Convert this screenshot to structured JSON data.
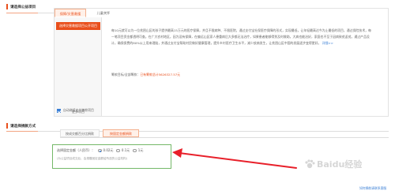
{
  "section1": {
    "title": "请选择公益项目",
    "tabs": [
      "保障/灾害救援",
      "儿童关怀"
    ],
    "selected_project_label": "选择灾害救援项目公开项目",
    "more_label": "更多项目",
    "description": "每10元就可以为一位贫困山区的孩子提供最高15万元的医疗保障，并且不限病种、不限医院，通过支付宝社保医疗保障的形式，实现最低，让年轻最高达今为止最低的项目，通过保险技术，每一笔项目资金都透明可查。在广大农村地区，因为没有保障，在偏远山区家人患重病后大多都无法治疗，如果患者能够得到及时救助，大病也能治好，家庭也不至于因病致贫返贫。通过产品设计，确保保费的80%以上用来理赔，并通过支付宝帮助村民做好健康管理，提升乡村医疗卫生水平，减少疾病发生，让贫困山区中国的发展逐步变得更好。",
    "description_link": "详细>>",
    "raised_label": "筹款目标/全部筹款",
    "raised_separator": "：",
    "raised_amount": "已有筹款总计5626327.57元",
    "checkbox_label": "自动继续支付善款项目"
  },
  "section2": {
    "title": "请选择捐款方式",
    "tabs": [
      "按成交额百分比捐款",
      "按固定金额捐款"
    ],
    "amount_label": "选择固定金额（人民币）：",
    "options": [
      "0.02元",
      "0.1元",
      "1元"
    ],
    "selected_option_index": 0,
    "note": "(为公益项目成交后，会捐赠固定金额给所选的公益机构)",
    "bottom_link": "如何捐款请联系客服",
    "watermark_text": "Baidu经验"
  },
  "colors": {
    "accent": "#e94f1c",
    "link": "#3a7fd5",
    "amount_border": "#74b868",
    "arrow": "#e8202a"
  },
  "icons": {
    "arrow": "red-arrow-icon",
    "checkbox": "checkbox-checked-icon",
    "watermark_paw": "baidu-paw-icon"
  }
}
